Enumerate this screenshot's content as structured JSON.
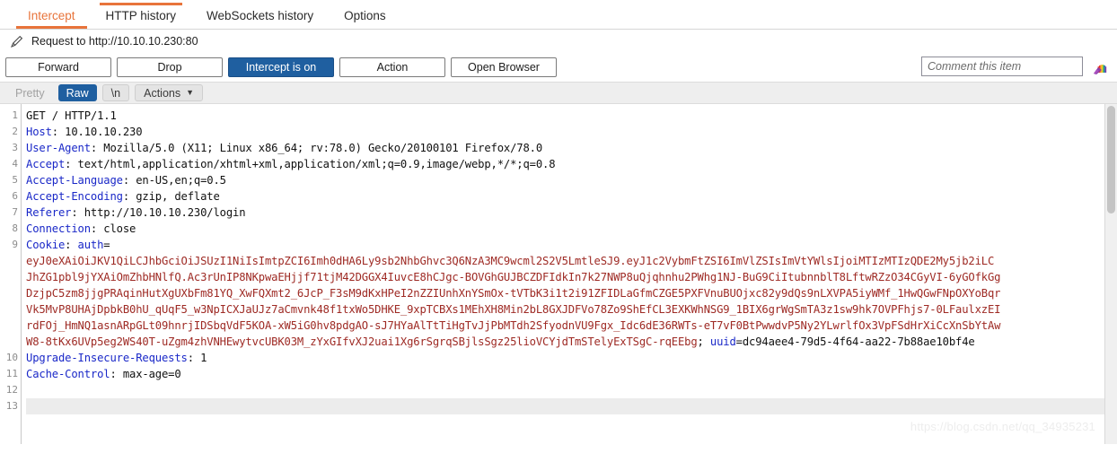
{
  "tabs": [
    {
      "label": "Intercept",
      "active": true,
      "topmark": false
    },
    {
      "label": "HTTP history",
      "active": false,
      "topmark": true
    },
    {
      "label": "WebSockets history",
      "active": false,
      "topmark": false
    },
    {
      "label": "Options",
      "active": false,
      "topmark": false
    }
  ],
  "request_bar": {
    "icon": "pencil-icon",
    "title": "Request to http://10.10.10.230:80"
  },
  "buttons": [
    {
      "label": "Forward",
      "style": "default",
      "name": "forward-button"
    },
    {
      "label": "Drop",
      "style": "default",
      "name": "drop-button"
    },
    {
      "label": "Intercept is on",
      "style": "primary",
      "name": "intercept-toggle-button"
    },
    {
      "label": "Action",
      "style": "default",
      "name": "action-button"
    },
    {
      "label": "Open Browser",
      "style": "default",
      "name": "open-browser-button"
    }
  ],
  "comment": {
    "value": "",
    "placeholder": "Comment this item",
    "highlighter_icon": "rainbow-highlighter-icon"
  },
  "viewbar": {
    "pretty": "Pretty",
    "raw": "Raw",
    "newline": "\\n",
    "actions": "Actions",
    "chevron": "⌄",
    "selected": "Raw"
  },
  "editor": {
    "line_numbers": [
      "1",
      "2",
      "3",
      "4",
      "5",
      "6",
      "7",
      "8",
      "9",
      "10",
      "11",
      "12",
      "13"
    ],
    "highlight_line": 13,
    "lines": [
      {
        "n": 1,
        "segments": [
          {
            "text": "GET / HTTP/1.1",
            "type": "plain"
          }
        ]
      },
      {
        "n": 2,
        "segments": [
          {
            "text": "Host",
            "type": "header"
          },
          {
            "text": ": 10.10.10.230",
            "type": "plain"
          }
        ]
      },
      {
        "n": 3,
        "segments": [
          {
            "text": "User-Agent",
            "type": "header"
          },
          {
            "text": ": Mozilla/5.0 (X11; Linux x86_64; rv:78.0) Gecko/20100101 Firefox/78.0",
            "type": "plain"
          }
        ]
      },
      {
        "n": 4,
        "segments": [
          {
            "text": "Accept",
            "type": "header"
          },
          {
            "text": ": text/html,application/xhtml+xml,application/xml;q=0.9,image/webp,*/*;q=0.8",
            "type": "plain"
          }
        ]
      },
      {
        "n": 5,
        "segments": [
          {
            "text": "Accept-Language",
            "type": "header"
          },
          {
            "text": ": en-US,en;q=0.5",
            "type": "plain"
          }
        ]
      },
      {
        "n": 6,
        "segments": [
          {
            "text": "Accept-Encoding",
            "type": "header"
          },
          {
            "text": ": gzip, deflate",
            "type": "plain"
          }
        ]
      },
      {
        "n": 7,
        "segments": [
          {
            "text": "Referer",
            "type": "header"
          },
          {
            "text": ": http://10.10.10.230/login",
            "type": "plain"
          }
        ]
      },
      {
        "n": 8,
        "segments": [
          {
            "text": "Connection",
            "type": "header"
          },
          {
            "text": ": close",
            "type": "plain"
          }
        ]
      },
      {
        "n": 9,
        "segments": [
          {
            "text": "Cookie",
            "type": "header"
          },
          {
            "text": ": ",
            "type": "plain"
          },
          {
            "text": "auth",
            "type": "header"
          },
          {
            "text": "=",
            "type": "plain"
          }
        ]
      },
      {
        "n": null,
        "segments": [
          {
            "text": "eyJ0eXAiOiJKV1QiLCJhbGciOiJSUzI1NiIsImtpZCI6Imh0dHA6Ly9sb2NhbGhvc3Q6NzA3MC9wcml2S2V5LmtleSJ9.eyJ1c2VybmFtZSI6ImVlZSIsImVtYWlsIjoiMTIzMTIzQDE2My5jb2iLC",
            "type": "token"
          }
        ]
      },
      {
        "n": null,
        "segments": [
          {
            "text": "JhZG1pbl9jYXAiOmZhbHNlfQ.Ac3rUnIP8NKpwaEHjjf71tjM42DGGX4IuvcE8hCJgc-BOVGhGUJBCZDFIdkIn7k27NWP8uQjqhnhu2PWhg1NJ-BuG9CiItubnnblT8LftwRZzO34CGyVI-6yGOfkGg",
            "type": "token"
          }
        ]
      },
      {
        "n": null,
        "segments": [
          {
            "text": "DzjpC5zm8jjgPRAqinHutXgUXbFm81YQ_XwFQXmt2_6JcP_F3sM9dKxHPeI2nZZIUnhXnYSmOx-tVTbK3i1t2i91ZFIDLaGfmCZGE5PXFVnuBUOjxc82y9dQs9nLXVPA5iyWMf_1HwQGwFNpOXYoBqr",
            "type": "token"
          }
        ]
      },
      {
        "n": null,
        "segments": [
          {
            "text": "Vk5MvP8UHAjDpbkB0hU_qUqF5_w3NpICXJaUJz7aCmvnk48f1txWo5DHKE_9xpTCBXs1MEhXH8Min2bL8GXJDFVo78Zo9ShEfCL3EXKWhNSG9_1BIX6grWgSmTA3z1sw9hk7OVPFhjs7-0LFaulxzEI",
            "type": "token"
          }
        ]
      },
      {
        "n": null,
        "segments": [
          {
            "text": "rdFOj_HmNQ1asnARpGLt09hnrjIDSbqVdF5KOA-xW5iG0hv8pdgAO-sJ7HYaAlTtTiHgTvJjPbMTdh2SfyodnVU9Fgx_Idc6dE36RWTs-eT7vF0BtPwwdvP5Ny2YLwrlfOx3VpFSdHrXiCcXnSbYtAw",
            "type": "token"
          }
        ]
      },
      {
        "n": null,
        "segments": [
          {
            "text": "W8-8tKx6UVp5eg2WS40T-uZgm4zhVNHEwytvcUBK03M_zYxGIfvXJ2uai1Xg6rSgrqSBjlsSgz25lioVCYjdTmSTelyExTSgC-rqEEbg",
            "type": "token"
          },
          {
            "text": "; ",
            "type": "plain"
          },
          {
            "text": "uuid",
            "type": "header"
          },
          {
            "text": "=dc94aee4-79d5-4f64-aa22-7b88ae10bf4e",
            "type": "plain"
          }
        ]
      },
      {
        "n": 10,
        "segments": [
          {
            "text": "Upgrade-Insecure-Requests",
            "type": "header"
          },
          {
            "text": ": 1",
            "type": "plain"
          }
        ]
      },
      {
        "n": 11,
        "segments": [
          {
            "text": "Cache-Control",
            "type": "header"
          },
          {
            "text": ": max-age=0",
            "type": "plain"
          }
        ]
      },
      {
        "n": 12,
        "segments": [
          {
            "text": "",
            "type": "plain"
          }
        ]
      },
      {
        "n": 13,
        "segments": [
          {
            "text": "",
            "type": "plain"
          }
        ],
        "highlighted": true
      }
    ]
  },
  "watermark": "https://blog.csdn.net/qq_34935231",
  "colors": {
    "accent_orange": "#e8743b",
    "primary_blue": "#1f5fa0",
    "header_blue": "#1a28c8",
    "token_red": "#9e2a24"
  }
}
